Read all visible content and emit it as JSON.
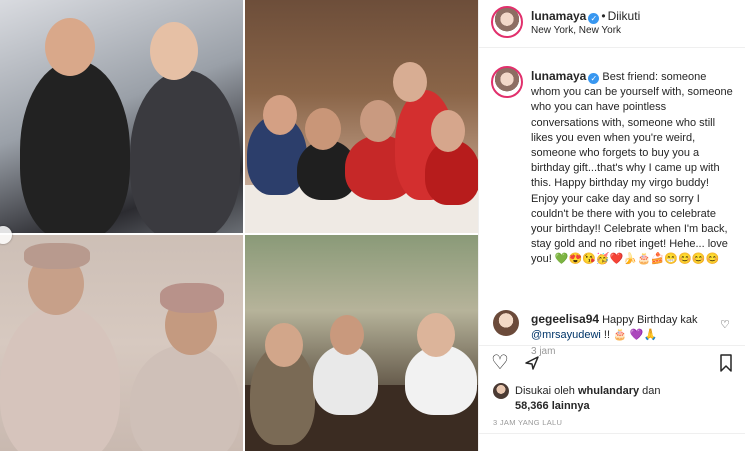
{
  "post": {
    "username": "lunamaya",
    "follow_status": "Diikuti",
    "location": "New York, New York"
  },
  "caption": {
    "username": "lunamaya",
    "text": "Best friend: someone whom you can be yourself with, someone who you can have pointless conversations with, someone who still likes you even when you're weird, someone who forgets to buy you a birthday gift...that's why I came up with this. Happy birthday my virgo buddy! Enjoy your cake day and so sorry I couldn't be there with you to celebrate your birthday!! Celebrate when I'm back, stay gold and no ribet inget! Hehe... love you! 💚😍😘🥳❤️🍌🎂🍰😁😊😊😊",
    "time": "3 jam"
  },
  "comment": {
    "username": "gegeelisa94",
    "text_before": "Happy Birthday kak ",
    "mention": "@mrsayudewi",
    "text_after": " !! 🎂 💜🙏"
  },
  "likes": {
    "prefix": "Disukai oleh ",
    "liker": "whulandary",
    "middle": " dan",
    "count": "58,366",
    "suffix": " lainnya"
  },
  "post_date": "3 JAM YANG LALU",
  "icons": {
    "like": "heart-outline-icon",
    "share": "share-icon",
    "save": "bookmark-icon",
    "comment_like": "heart-small-icon",
    "verified": "verified-badge-icon"
  },
  "colors": {
    "verified": "#3897f0",
    "mention": "#003569",
    "meta": "#999999"
  }
}
